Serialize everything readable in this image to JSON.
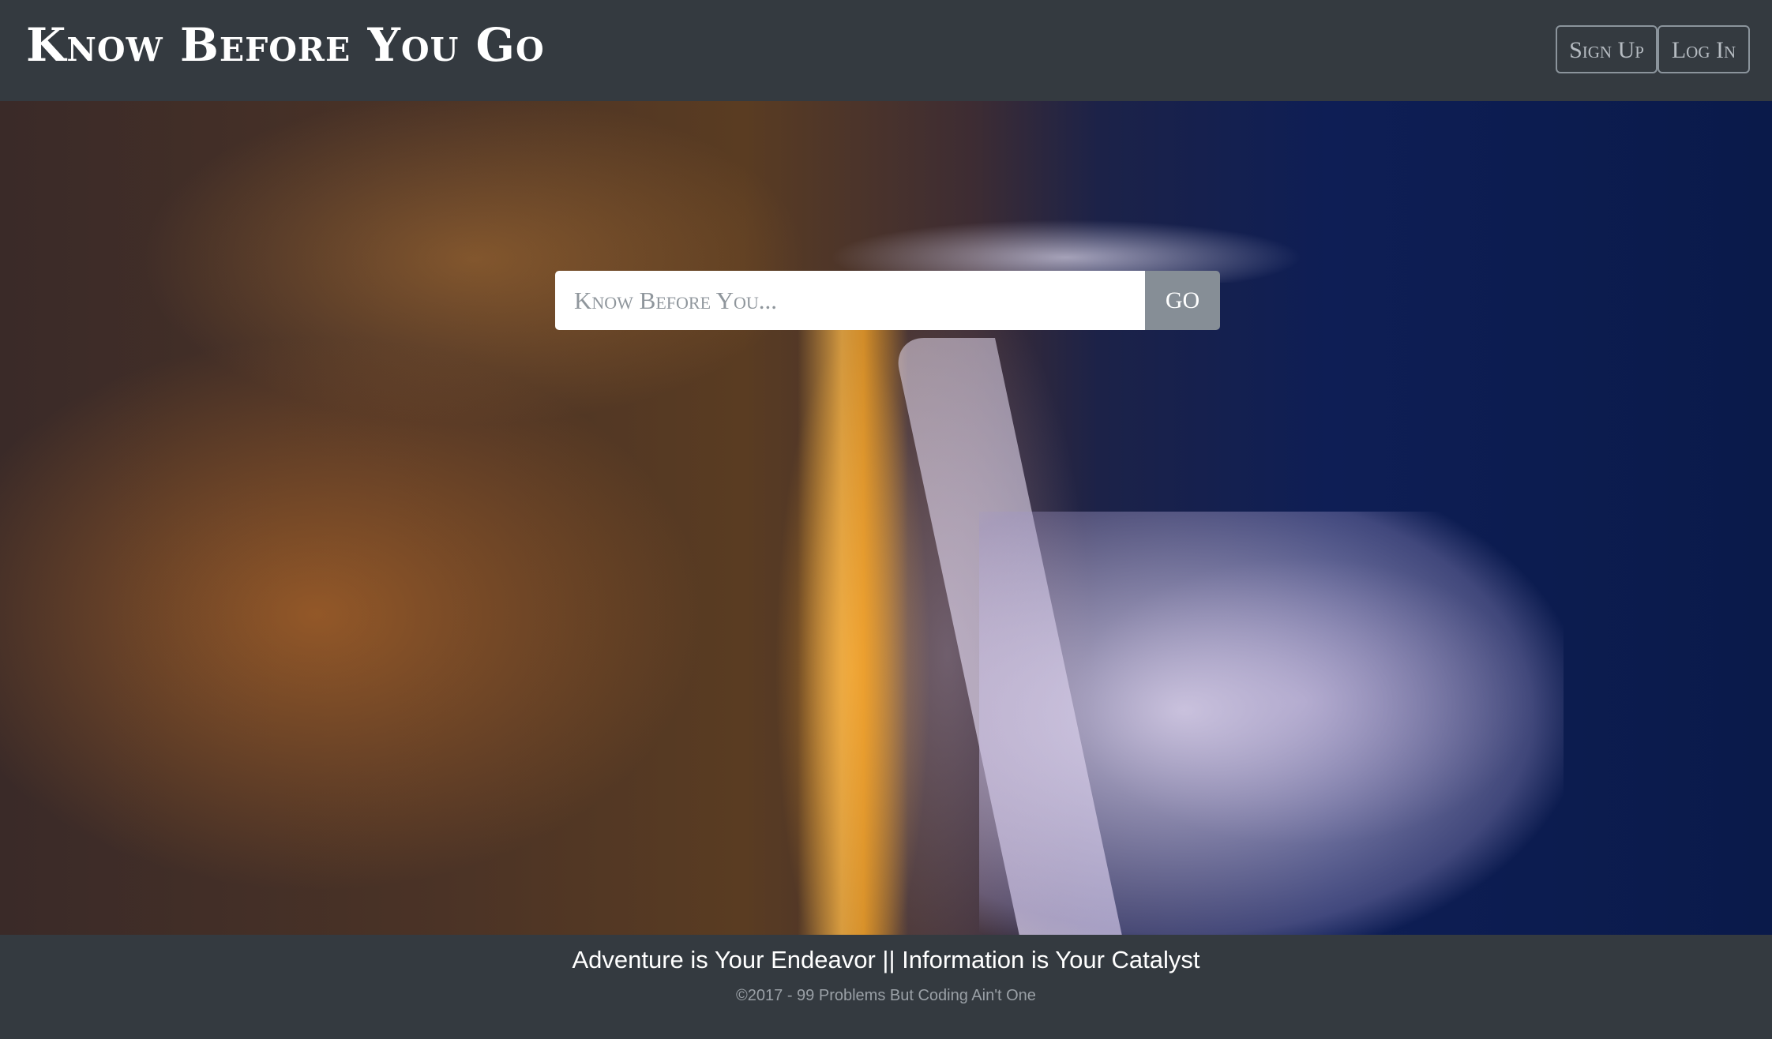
{
  "navbar": {
    "brand": "Know Before You Go",
    "signup_label": "Sign Up",
    "login_label": "Log In"
  },
  "hero": {
    "image": "city-skyline-night-lakeshore",
    "search_placeholder": "Know Before You...",
    "search_value": "",
    "go_label": "GO"
  },
  "footer": {
    "tagline": "Adventure is Your Endeavor || Information is Your Catalyst",
    "copyright": "©2017 - 99 Problems But Coding Ain't One"
  }
}
